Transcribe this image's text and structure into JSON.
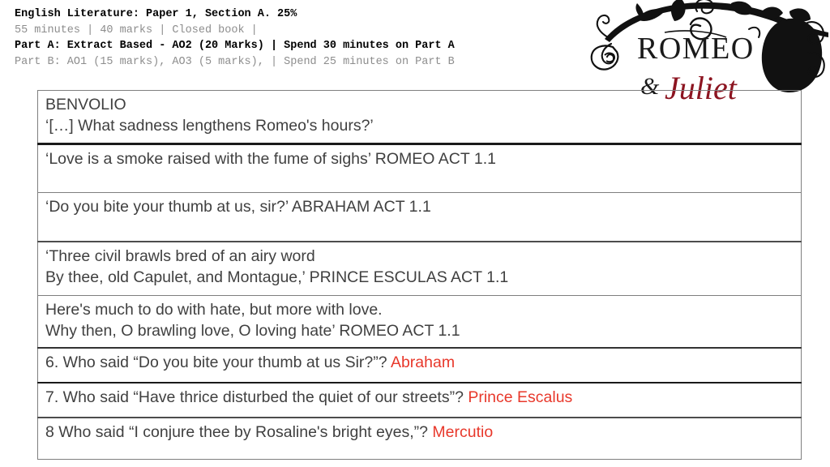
{
  "header": {
    "lines": [
      {
        "text": "English Literature: Paper 1, Section A. 25%",
        "style": "bold"
      },
      {
        "text": "55 minutes | 40 marks | Closed book |",
        "style": "light"
      },
      {
        "text": "Part A: Extract Based - AO2 (20 Marks) | Spend 30 minutes on Part A",
        "style": "bold"
      },
      {
        "text": "Part B: AO1 (15 marks), AO3 (5 marks), | Spend 25 minutes on Part B",
        "style": "light"
      }
    ]
  },
  "logo": {
    "title_main": "ROMEO",
    "title_script": "Juliet",
    "ampersand": "&",
    "colors": {
      "vine": "#111111",
      "main": "#1a1a1a",
      "script": "#8c1420"
    }
  },
  "table": {
    "rows": [
      {
        "name": "row-benvolio",
        "lines": [
          {
            "text": "BENVOLIO"
          },
          {
            "text": "‘[…] What sadness lengthens Romeo's hours?’"
          }
        ]
      },
      {
        "name": "row-love-is-a-smoke",
        "lines": [
          {
            "text": "‘Love is a smoke raised with the fume of sighs’ ROMEO ACT 1.1"
          }
        ]
      },
      {
        "name": "row-bite-thumb",
        "lines": [
          {
            "text": "‘Do you bite your thumb at us, sir?’ ABRAHAM ACT 1.1"
          }
        ]
      },
      {
        "name": "row-three-civil-brawls",
        "lines": [
          {
            "text": "‘Three civil brawls bred of an airy word"
          },
          {
            "text": "By thee, old Capulet, and Montague,’ PRINCE ESCULAS ACT 1.1"
          }
        ]
      },
      {
        "name": "row-hate-love",
        "lines": [
          {
            "text": "Here's much to do with hate, but more with love."
          },
          {
            "text": "Why then, O brawling love, O loving hate’ ROMEO ACT 1.1"
          }
        ]
      },
      {
        "name": "row-question-6",
        "question": "6. Who said “Do you bite your thumb at us Sir?”? ",
        "answer": "Abraham"
      },
      {
        "name": "row-question-7",
        "question": "7. Who said “Have thrice disturbed the quiet of our streets”? ",
        "answer": "Prince Escalus"
      },
      {
        "name": "row-question-8",
        "question": "8 Who said “I conjure thee by Rosaline's bright eyes,”? ",
        "answer": "Mercutio"
      }
    ]
  }
}
